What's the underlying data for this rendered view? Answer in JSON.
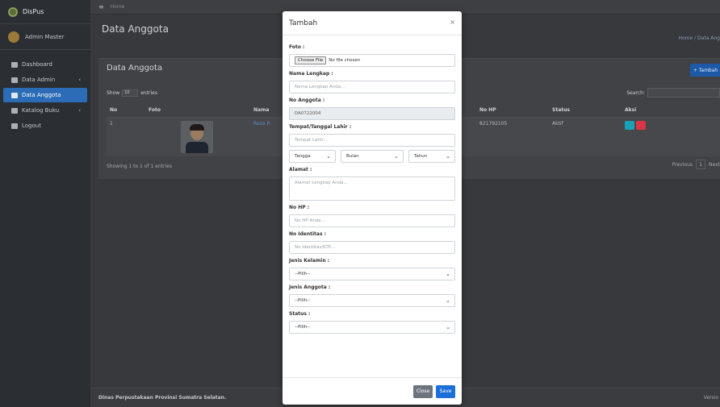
{
  "sidebar": {
    "brand": "DisPus",
    "user": "Admin Master",
    "items": [
      {
        "label": "Dashboard",
        "icon": "dashboard-icon"
      },
      {
        "label": "Data Admin",
        "icon": "users-icon"
      },
      {
        "label": "Data Anggota",
        "icon": "book-icon"
      },
      {
        "label": "Katalog Buku",
        "icon": "books-icon"
      },
      {
        "label": "Logout",
        "icon": "logout-icon"
      }
    ]
  },
  "topbar": {
    "home": "Home"
  },
  "page": {
    "title": "Data Anggota",
    "breadcrumb": "Home / Data Ang"
  },
  "card": {
    "title": "Data Anggota",
    "add_button": "+ Tambah",
    "show_label": "Show",
    "entries_value": "10",
    "entries_label": "entries",
    "search_label": "Search:",
    "columns": [
      "No",
      "Foto",
      "Nama",
      "No HP",
      "Status",
      "Aksi"
    ],
    "rows": [
      {
        "no": "1",
        "nama": "Reza R",
        "hp": "821792105",
        "status": "Aktif"
      }
    ],
    "showing": "Showing 1 to 1 of 1 entries",
    "prev": "Previous",
    "page": "1",
    "next": "Next"
  },
  "footer": {
    "text": "Dinas Perpustakaan Provinsi Sumatra Selatan.",
    "version": "Versio"
  },
  "modal": {
    "title": "Tambah",
    "close_symbol": "×",
    "foto_label": "Foto :",
    "file_button": "Choose File",
    "file_text": "No file chosen",
    "nama_label": "Nama Lengkap :",
    "nama_placeholder": "Nama Lengkap Anda...",
    "noanggota_label": "No Anggota :",
    "noanggota_value": "DA0722004",
    "ttl_label": "Tempat/Tanggal Lahir :",
    "tempat_placeholder": "Tempat Lahir...",
    "tanggal": "Tangga",
    "bulan": "Bulan",
    "tahun": "Tahun",
    "alamat_label": "Alamat :",
    "alamat_placeholder": "Alamat Lengkap Anda...",
    "hp_label": "No HP :",
    "hp_placeholder": "No HP Anda...",
    "identitas_label": "No Identitas :",
    "identitas_placeholder": "No Identitas/KTP...",
    "jk_label": "Jenis Kelamin :",
    "jk_value": "--Pilih--",
    "ja_label": "Jenis Anggota :",
    "ja_value": "--Pilih--",
    "status_label": "Status :",
    "status_value": "--Pilih--",
    "close_button": "Close",
    "save_button": "Save"
  },
  "colors": {
    "accent": "#1d6fd8",
    "sidebar_active": "#2c6bb5",
    "edit": "#17a2b8",
    "delete": "#dc3545"
  }
}
